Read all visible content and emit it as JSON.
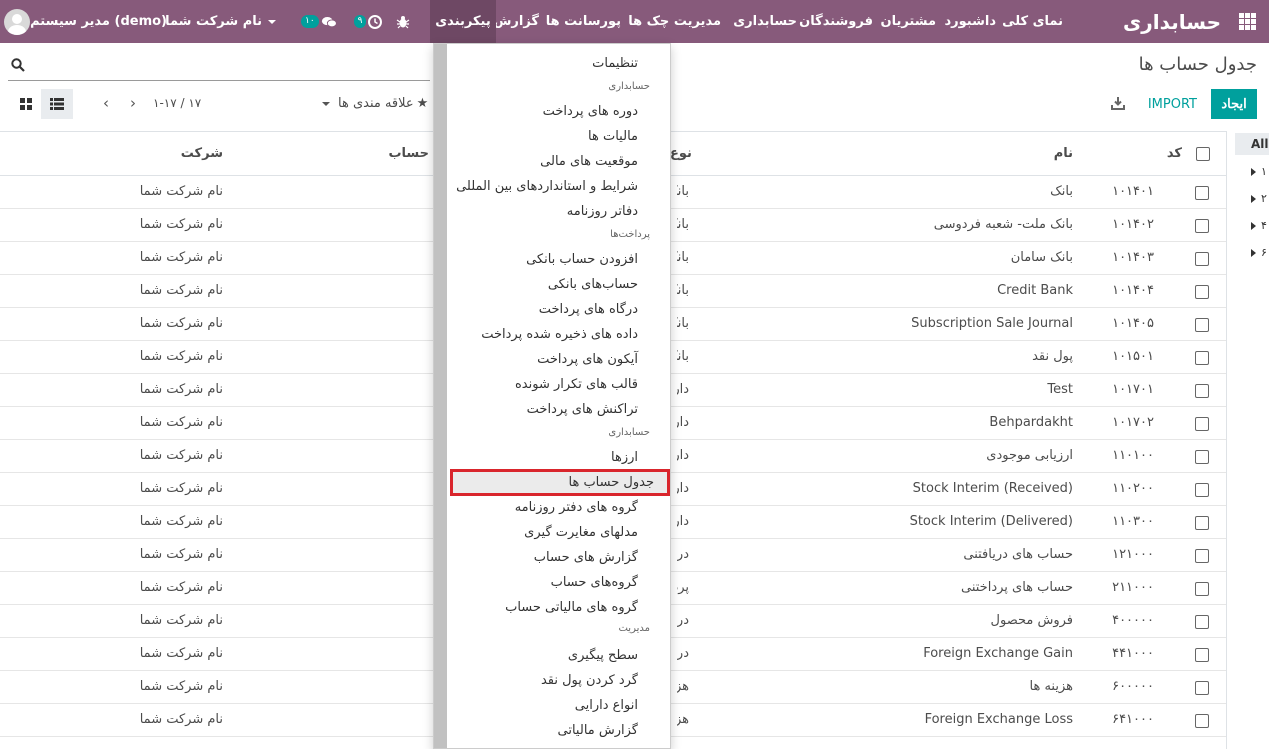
{
  "navbar": {
    "brand": "حسابداری",
    "menu": [
      "نمای کلی",
      "داشبورد",
      "مشتریان",
      "فروشندگان",
      "حسابداری",
      "مدیریت چک ها",
      "پورسانت ها",
      "گزارش",
      "پیکربندی"
    ],
    "activities_count": "۹",
    "messages_count": "۱۰",
    "company": "نام شرکت شما",
    "user": "مدیر سیستم (demo)",
    "accent": "#875a7b"
  },
  "control": {
    "title": "جدول حساب ها",
    "create": "ایجاد",
    "import": "IMPORT",
    "favorites": "علاقه مندی ها",
    "pager": "۱-۱۷ / ۱۷",
    "accent": "#00a09d"
  },
  "table": {
    "headers": {
      "code": "کد",
      "name": "نام",
      "type": "نوع",
      "account": "حساب",
      "company": "شرکت"
    },
    "rows": [
      {
        "code": "۱۰۱۴۰۱",
        "name": "بانک",
        "type": "بانک",
        "company": "نام شرکت شما"
      },
      {
        "code": "۱۰۱۴۰۲",
        "name": "بانک ملت- شعبه فردوسی",
        "type": "بانک",
        "company": "نام شرکت شما"
      },
      {
        "code": "۱۰۱۴۰۳",
        "name": "بانک سامان",
        "type": "بانک",
        "company": "نام شرکت شما"
      },
      {
        "code": "۱۰۱۴۰۴",
        "name": "Credit Bank",
        "type": "بانک",
        "company": "نام شرکت شما"
      },
      {
        "code": "۱۰۱۴۰۵",
        "name": "Subscription Sale Journal",
        "type": "بانک",
        "company": "نام شرکت شما"
      },
      {
        "code": "۱۰۱۵۰۱",
        "name": "پول نقد",
        "type": "بانک",
        "company": "نام شرکت شما"
      },
      {
        "code": "۱۰۱۷۰۱",
        "name": "Test",
        "type": "دارا",
        "company": "نام شرکت شما"
      },
      {
        "code": "۱۰۱۷۰۲",
        "name": "Behpardakht",
        "type": "دارا",
        "company": "نام شرکت شما"
      },
      {
        "code": "۱۱۰۱۰۰",
        "name": "ارزیابی موجودی",
        "type": "دارا",
        "company": "نام شرکت شما"
      },
      {
        "code": "۱۱۰۲۰۰",
        "name": "Stock Interim (Received)",
        "type": "دارا",
        "company": "نام شرکت شما"
      },
      {
        "code": "۱۱۰۳۰۰",
        "name": "Stock Interim (Delivered)",
        "type": "دارا",
        "company": "نام شرکت شما"
      },
      {
        "code": "۱۲۱۰۰۰",
        "name": "حساب های دریافتنی",
        "type": "دریا",
        "company": "نام شرکت شما"
      },
      {
        "code": "۲۱۱۰۰۰",
        "name": "حساب های پرداختنی",
        "type": "پردا",
        "company": "نام شرکت شما"
      },
      {
        "code": "۴۰۰۰۰۰",
        "name": "فروش محصول",
        "type": "درآم",
        "company": "نام شرکت شما"
      },
      {
        "code": "۴۴۱۰۰۰",
        "name": "Foreign Exchange Gain",
        "type": "درآم",
        "company": "نام شرکت شما"
      },
      {
        "code": "۶۰۰۰۰۰",
        "name": "هزینه ها",
        "type": "هزی",
        "company": "نام شرکت شما"
      },
      {
        "code": "۶۴۱۰۰۰",
        "name": "Foreign Exchange Loss",
        "type": "هزی",
        "company": "نام شرکت شما"
      }
    ]
  },
  "sidebar": {
    "all": "All",
    "items": [
      "۱",
      "۲",
      "۴",
      "۶"
    ]
  },
  "dropdown": {
    "items": [
      {
        "kind": "item",
        "label": "تنظیمات"
      },
      {
        "kind": "header",
        "label": "حسابداری"
      },
      {
        "kind": "item",
        "label": "دوره های پرداخت"
      },
      {
        "kind": "item",
        "label": "مالیات ها"
      },
      {
        "kind": "item",
        "label": "موقعیت های مالی"
      },
      {
        "kind": "item",
        "label": "شرایط و استانداردهای بین المللی"
      },
      {
        "kind": "item",
        "label": "دفاتر روزنامه"
      },
      {
        "kind": "header",
        "label": "پرداخت‌ها"
      },
      {
        "kind": "item",
        "label": "افزودن حساب بانکی"
      },
      {
        "kind": "item",
        "label": "حساب‌های بانکی"
      },
      {
        "kind": "item",
        "label": "درگاه های پرداخت"
      },
      {
        "kind": "item",
        "label": "داده های ذخیره شده پرداخت"
      },
      {
        "kind": "item",
        "label": "آیکون های پرداخت"
      },
      {
        "kind": "item",
        "label": "قالب های تکرار شونده"
      },
      {
        "kind": "item",
        "label": "تراکنش های پرداخت"
      },
      {
        "kind": "header",
        "label": "حسابداری"
      },
      {
        "kind": "item",
        "label": "ارزها"
      },
      {
        "kind": "selected",
        "label": "جدول حساب ها"
      },
      {
        "kind": "item",
        "label": "گروه های دفتر روزنامه"
      },
      {
        "kind": "item",
        "label": "مدلهای مغایرت گیری"
      },
      {
        "kind": "item",
        "label": "گزارش های حساب"
      },
      {
        "kind": "item",
        "label": "گروه‌های حساب"
      },
      {
        "kind": "item",
        "label": "گروه های مالیاتی حساب"
      },
      {
        "kind": "header",
        "label": "مدیریت"
      },
      {
        "kind": "item",
        "label": "سطح پیگیری"
      },
      {
        "kind": "item",
        "label": "گرد کردن پول نقد"
      },
      {
        "kind": "item",
        "label": "انواع دارایی"
      },
      {
        "kind": "item",
        "label": "گزارش مالیاتی"
      }
    ],
    "highlight_color": "#d9252c"
  }
}
